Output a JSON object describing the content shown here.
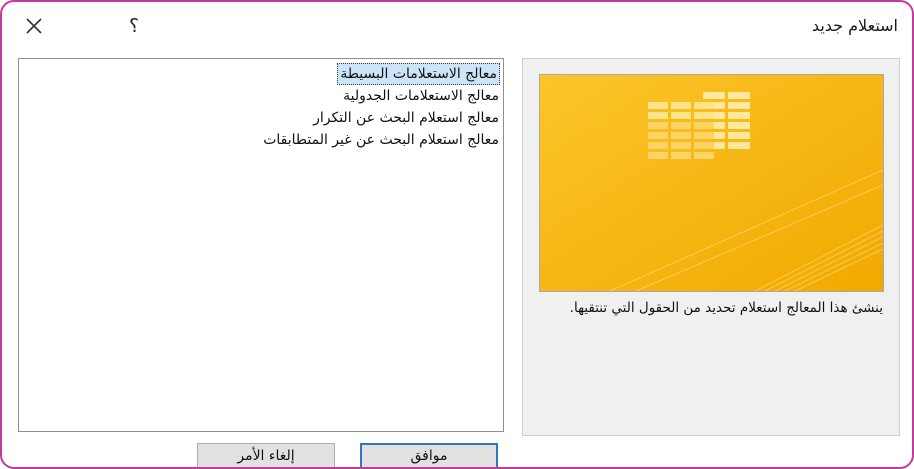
{
  "window": {
    "title": "استعلام جديد",
    "close_icon": "close-icon",
    "help_label": "؟"
  },
  "preview": {
    "image_icon": "query-wizard-illustration",
    "colors": {
      "background": "#f7b80a",
      "accent": "#fde38a"
    },
    "description": "ينشئ هذا المعالج استعلام تحديد من الحقول التي تنتقيها."
  },
  "wizards": {
    "items": [
      {
        "label": "معالج الاستعلامات البسيطة",
        "selected": true
      },
      {
        "label": "معالج الاستعلامات الجدولية",
        "selected": false
      },
      {
        "label": "معالج استعلام البحث عن التكرار",
        "selected": false
      },
      {
        "label": "معالج استعلام البحث عن غير المتطابقات",
        "selected": false
      }
    ]
  },
  "buttons": {
    "ok_label": "موافق",
    "cancel_label": "إلغاء الأمر"
  }
}
